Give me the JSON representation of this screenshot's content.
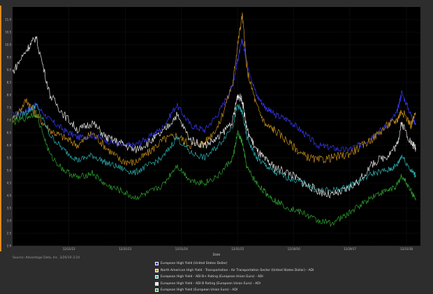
{
  "chart_data": {
    "type": "line",
    "xlabel": "Date",
    "ylabel": "",
    "ylim": [
      2.0,
      11.5
    ],
    "y_ticks": [
      "2.0",
      "2.5",
      "3.0",
      "3.5",
      "4.0",
      "4.5",
      "5.0",
      "5.5",
      "6.0",
      "6.5",
      "7.0",
      "7.5",
      "8.0",
      "8.5",
      "9.0",
      "9.5",
      "10.0",
      "10.5",
      "11.0"
    ],
    "x_ticks": [
      "12/31/12",
      "12/31/13",
      "12/31/14",
      "12/31/15",
      "12/30/16",
      "12/29/17",
      "12/31/18"
    ],
    "source": "Source: Advantage Data, Inc. 3/26/19 3:24",
    "grid": true,
    "x": [
      "2012-01",
      "2012-04",
      "2012-06",
      "2012-09",
      "2012-12",
      "2013-03",
      "2013-06",
      "2013-09",
      "2013-12",
      "2014-03",
      "2014-06",
      "2014-09",
      "2014-12",
      "2015-03",
      "2015-06",
      "2015-09",
      "2015-12",
      "2016-01",
      "2016-02",
      "2016-03",
      "2016-05",
      "2016-07",
      "2016-09",
      "2016-12",
      "2017-03",
      "2017-06",
      "2017-09",
      "2017-12",
      "2018-03",
      "2018-06",
      "2018-09",
      "2018-11",
      "2018-12",
      "2019-02",
      "2019-03"
    ],
    "series": [
      {
        "name": "European High Yield (United States Dollar)",
        "color": "#3a3aff",
        "values": [
          7.2,
          7.4,
          7.6,
          7.0,
          6.6,
          6.3,
          6.4,
          6.2,
          6.0,
          6.0,
          6.3,
          6.7,
          7.6,
          6.8,
          6.6,
          7.3,
          8.4,
          9.4,
          10.2,
          9.3,
          8.0,
          7.5,
          7.2,
          7.0,
          6.5,
          6.0,
          5.9,
          5.8,
          6.0,
          6.4,
          6.8,
          7.3,
          8.1,
          7.2,
          6.8
        ]
      },
      {
        "name": "North American High Yield - Transportation - Air Transportation Sector (United States Dollar) - ADI",
        "color": "#c8901a",
        "values": [
          7.0,
          7.8,
          7.2,
          6.6,
          6.3,
          6.0,
          6.5,
          5.9,
          5.4,
          5.3,
          5.7,
          6.2,
          6.4,
          6.0,
          6.1,
          6.8,
          8.5,
          10.0,
          11.2,
          9.0,
          7.6,
          6.8,
          6.6,
          6.1,
          5.6,
          5.4,
          5.5,
          5.6,
          5.9,
          6.3,
          6.8,
          7.0,
          7.4,
          6.8,
          7.3
        ]
      },
      {
        "name": "European High Yield - ADI B+ Rating (European Union Euro) - ADI",
        "color": "#2eb0b0",
        "values": [
          7.1,
          7.3,
          7.6,
          6.4,
          5.8,
          5.4,
          5.6,
          5.3,
          5.1,
          4.9,
          5.2,
          5.5,
          6.3,
          5.7,
          5.5,
          6.0,
          6.8,
          7.6,
          7.3,
          6.3,
          5.5,
          5.2,
          4.9,
          4.7,
          4.5,
          4.2,
          4.2,
          4.3,
          4.6,
          4.9,
          5.0,
          5.2,
          5.6,
          5.0,
          4.8
        ]
      },
      {
        "name": "European High Yield - ADI B Rating (European Union Euro) - ADI",
        "color": "#e8e8e8",
        "values": [
          8.9,
          9.8,
          10.3,
          8.0,
          7.2,
          6.6,
          6.9,
          6.3,
          6.1,
          5.8,
          6.1,
          6.5,
          7.2,
          6.2,
          6.0,
          6.3,
          7.0,
          8.0,
          7.8,
          6.6,
          5.8,
          5.4,
          5.1,
          4.9,
          4.5,
          4.2,
          4.0,
          4.2,
          4.6,
          5.3,
          5.6,
          6.0,
          6.9,
          6.1,
          5.9
        ]
      },
      {
        "name": "European High Yield (European Union Euro) - ADI",
        "color": "#2fa82f",
        "values": [
          6.9,
          7.1,
          7.3,
          5.6,
          5.0,
          4.7,
          4.9,
          4.4,
          4.2,
          3.9,
          4.1,
          4.4,
          5.2,
          4.6,
          4.5,
          4.8,
          5.5,
          6.5,
          6.1,
          5.1,
          4.5,
          4.1,
          3.8,
          3.5,
          3.3,
          3.0,
          2.9,
          3.2,
          3.6,
          4.0,
          4.2,
          4.4,
          4.8,
          4.2,
          3.8
        ]
      }
    ]
  }
}
